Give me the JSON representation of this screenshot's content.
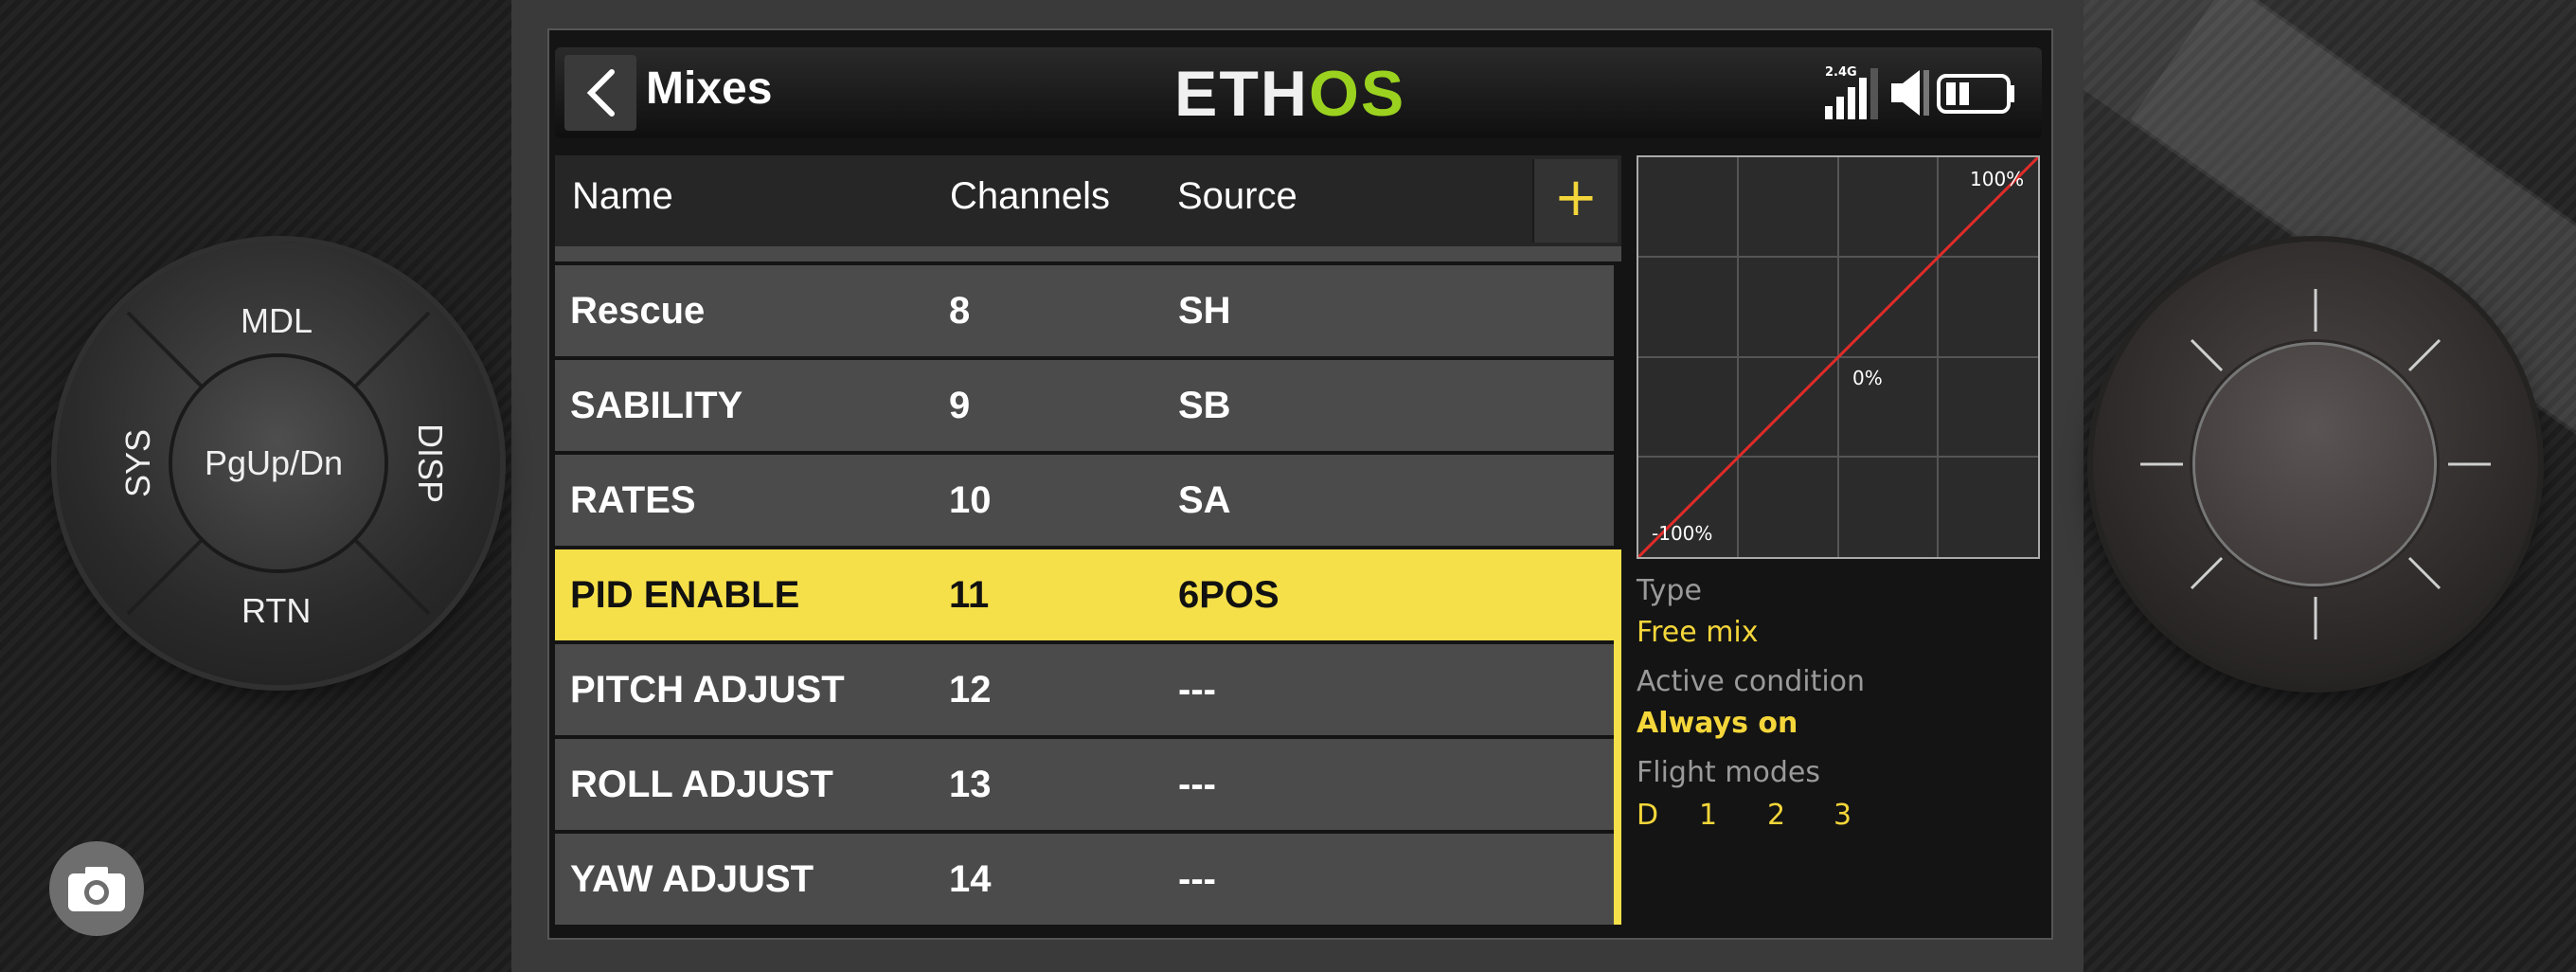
{
  "header": {
    "title": "Mixes",
    "logo_part1": "ETH",
    "logo_part2": "OS",
    "rf_band": "2.4G"
  },
  "table": {
    "columns": [
      "Name",
      "Channels",
      "Source"
    ],
    "add_label": "+",
    "rows": [
      {
        "name": "Rescue",
        "channel": "8",
        "source": "SH"
      },
      {
        "name": "SABILITY",
        "channel": "9",
        "source": "SB"
      },
      {
        "name": "RATES",
        "channel": "10",
        "source": "SA"
      },
      {
        "name": "PID ENABLE",
        "channel": "11",
        "source": "6POS",
        "selected": true
      },
      {
        "name": "PITCH ADJUST",
        "channel": "12",
        "source": "---"
      },
      {
        "name": "ROLL ADJUST",
        "channel": "13",
        "source": "---"
      },
      {
        "name": "YAW ADJUST",
        "channel": "14",
        "source": "---"
      }
    ]
  },
  "curve": {
    "label_max": "100%",
    "label_mid": "0%",
    "label_min": "-100%"
  },
  "details": {
    "type_label": "Type",
    "type_value": "Free mix",
    "active_label": "Active condition",
    "active_value": "Always on",
    "flight_modes_label": "Flight modes",
    "flight_modes": [
      "D",
      "1",
      "2",
      "3"
    ]
  },
  "hardware": {
    "dial_top": "MDL",
    "dial_left": "SYS",
    "dial_right": "DISP",
    "dial_bottom": "RTN",
    "dial_center": "PgUp/Dn"
  },
  "colors": {
    "accent_yellow": "#f6e04a",
    "logo_green": "#9ad21f",
    "curve_red": "#e02b2b"
  }
}
